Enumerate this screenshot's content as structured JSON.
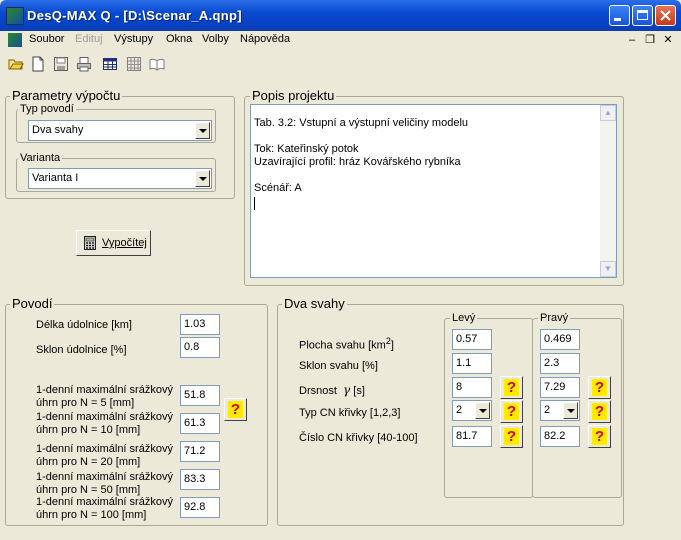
{
  "window": {
    "title": "DesQ-MAX Q - [D:\\Scenar_A.qnp]"
  },
  "menu": {
    "items": [
      "Soubor",
      "Edituj",
      "Výstupy",
      "Okna",
      "Volby",
      "Nápověda"
    ],
    "mdi": {
      "minimize": "–",
      "restore": "❐",
      "close": "✕"
    }
  },
  "toolbar": {
    "icons": [
      "open-folder-icon",
      "new-document-icon",
      "save-icon",
      "print-icon",
      "table-icon",
      "grid-icon",
      "book-icon"
    ]
  },
  "params": {
    "legend": "Parametry výpočtu",
    "typ_legend": "Typ povodí",
    "typ_value": "Dva svahy",
    "varianta_legend": "Varianta",
    "varianta_value": "Varianta I",
    "calc_button": "Vypočítej"
  },
  "popis": {
    "legend": "Popis projektu",
    "text": "Tab. 3.2: Vstupní a výstupní veličiny modelu\n\nTok: Kateřinský potok\nUzavírající profil: hráz Kovářského rybníka\n\nScénář: A\n"
  },
  "povodi": {
    "legend": "Povodí",
    "delka_label": "Délka údolnice [km]",
    "delka_value": "1.03",
    "sklon_label": "Sklon údolnice [%]",
    "sklon_value": "0.8",
    "precip": [
      {
        "line1": "1-denní maximální srážkový",
        "line2": "úhrn pro N = 5 [mm]",
        "value": "51.8"
      },
      {
        "line1": "1-denní maximální srážkový",
        "line2": "úhrn pro N = 10 [mm]",
        "value": "61.3"
      },
      {
        "line1": "1-denní maximální srážkový",
        "line2": "úhrn pro N = 20 [mm]",
        "value": "71.2"
      },
      {
        "line1": "1-denní maximální srážkový",
        "line2": "úhrn pro N = 50 [mm]",
        "value": "83.3"
      },
      {
        "line1": "1-denní maximální srážkový",
        "line2": "úhrn pro N = 100 [mm]",
        "value": "92.8"
      }
    ],
    "help_glyph": "?"
  },
  "svahy": {
    "legend": "Dva svahy",
    "levy_legend": "Levý",
    "pravy_legend": "Pravý",
    "labels": {
      "plocha": "Plocha svahu [km",
      "plocha_sup": "2",
      "plocha_end": "]",
      "sklon": "Sklon svahu [%]",
      "drsnost": "Drsnost",
      "drsnost_symbol": "γ",
      "drsnost_unit": "[s]",
      "typ": "Typ CN křivky [1,2,3]",
      "cislo": "Číslo CN křivky [40-100]"
    },
    "levy": {
      "plocha": "0.57",
      "sklon": "1.1",
      "drsnost": "8",
      "typ": "2",
      "cislo": "81.7"
    },
    "pravy": {
      "plocha": "0.469",
      "sklon": "2.3",
      "drsnost": "7.29",
      "typ": "2",
      "cislo": "82.2"
    },
    "help_glyph": "?"
  }
}
